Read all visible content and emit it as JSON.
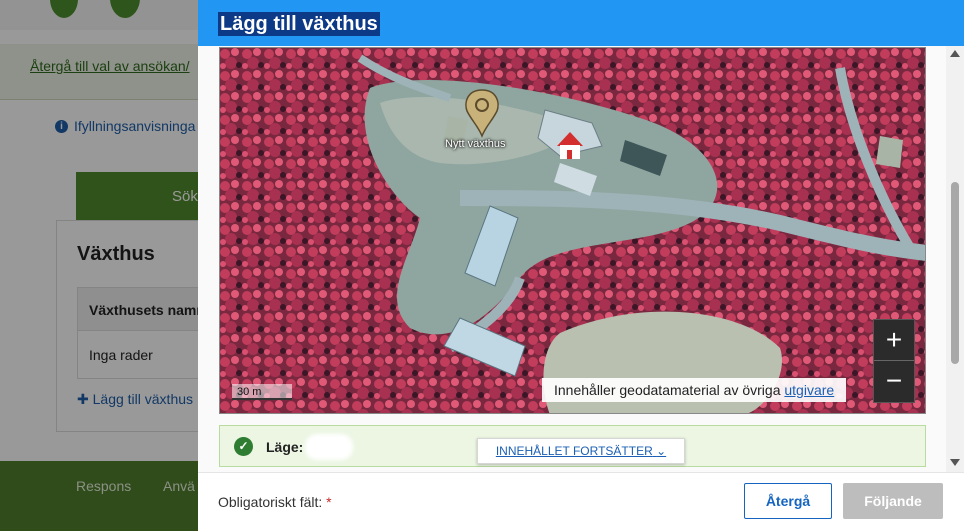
{
  "background": {
    "back_link": "Återgå till val av ansökan/",
    "info_link": "Ifyllningsanvisninga",
    "tab_label": "Sök",
    "section_title": "Växthus",
    "table_header": "Växthusets namn",
    "empty_row": "Inga rader",
    "add_link": "Lägg till växthus",
    "footer_links": [
      "Respons",
      "Anvä"
    ]
  },
  "modal": {
    "title": "Lägg till växthus",
    "map": {
      "pin_label": "Nytt växthus",
      "zoom_in": "+",
      "zoom_out": "−",
      "scale": "30 m",
      "attribution_text": "Innehåller geodatamaterial av övriga ",
      "attribution_link": "utgivare"
    },
    "location": {
      "label": "Läge:",
      "continues": "INNEHÅLLET FORTSÄTTER"
    },
    "footer": {
      "required_text": "Obligatoriskt fält:",
      "required_star": "*",
      "back_button": "Återgå",
      "next_button": "Följande"
    }
  },
  "colors": {
    "header_blue": "#2196f3",
    "title_highlight": "#0d3a86",
    "primary_blue": "#1565c0",
    "success_green": "#2e7d32",
    "disabled_gray": "#bdbdbd"
  },
  "icons": {
    "info": "info-icon",
    "check": "check-circle-icon",
    "pin": "map-pin-icon",
    "chevron": "chevron-down-icon"
  }
}
